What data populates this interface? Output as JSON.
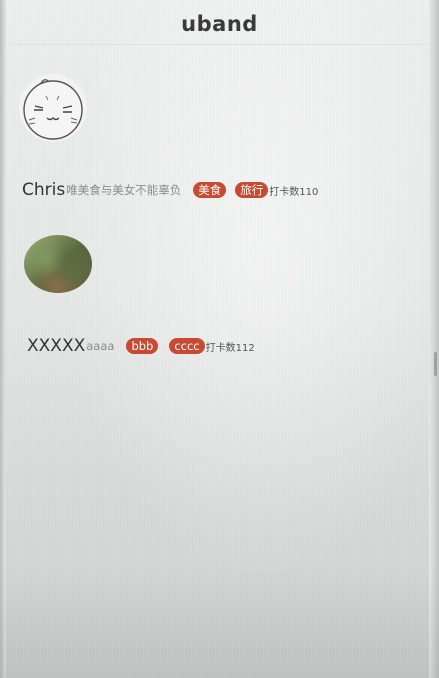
{
  "app": {
    "title": "uband"
  },
  "users": [
    {
      "name": "Chris",
      "bio": "唯美食与美女不能辜负",
      "tags": [
        "美食",
        "旅行"
      ],
      "checkin": "打卡数110",
      "avatar": "cartoon-avatar"
    },
    {
      "name": "XXXXX",
      "bio": "aaaa",
      "tags": [
        "bbb",
        "cccc"
      ],
      "checkin": "打卡数112",
      "avatar": "photo-avatar"
    }
  ],
  "colors": {
    "tag_background": "#c84a32",
    "tag_text": "#ffffff",
    "name_text": "#333333",
    "bio_text": "#8b8d8c"
  }
}
